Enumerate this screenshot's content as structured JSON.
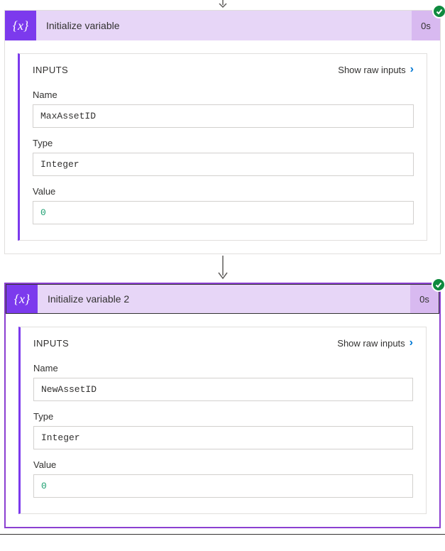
{
  "cards": [
    {
      "icon_text": "{x}",
      "title": "Initialize variable",
      "duration": "0s",
      "section_title": "INPUTS",
      "show_raw_label": "Show raw inputs",
      "fields": {
        "name_label": "Name",
        "name_value": "MaxAssetID",
        "type_label": "Type",
        "type_value": "Integer",
        "value_label": "Value",
        "value_value": "0"
      }
    },
    {
      "icon_text": "{x}",
      "title": "Initialize variable 2",
      "duration": "0s",
      "section_title": "INPUTS",
      "show_raw_label": "Show raw inputs",
      "fields": {
        "name_label": "Name",
        "name_value": "NewAssetID",
        "type_label": "Type",
        "type_value": "Integer",
        "value_label": "Value",
        "value_value": "0"
      }
    }
  ]
}
